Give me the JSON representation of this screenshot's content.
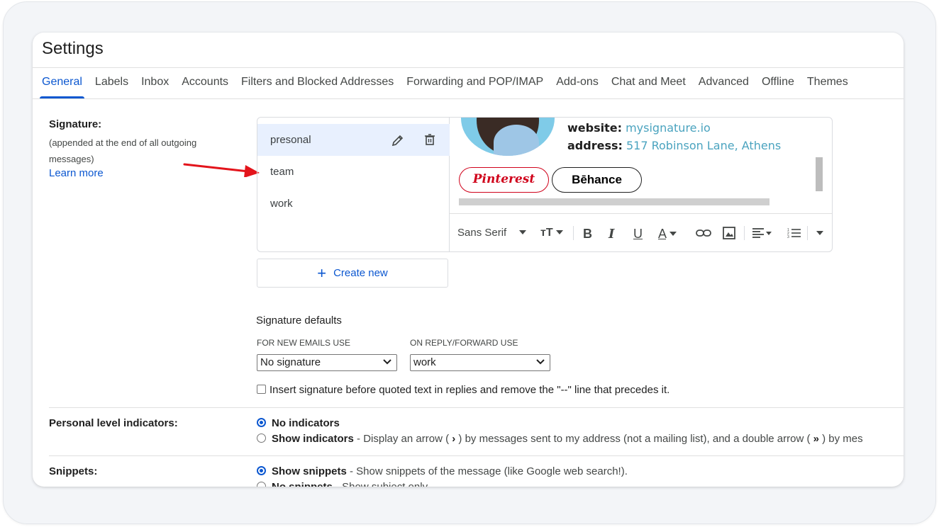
{
  "header": {
    "title": "Settings"
  },
  "tabs": [
    {
      "label": "General",
      "active": true
    },
    {
      "label": "Labels"
    },
    {
      "label": "Inbox"
    },
    {
      "label": "Accounts"
    },
    {
      "label": "Filters and Blocked Addresses"
    },
    {
      "label": "Forwarding and POP/IMAP"
    },
    {
      "label": "Add-ons"
    },
    {
      "label": "Chat and Meet"
    },
    {
      "label": "Advanced"
    },
    {
      "label": "Offline"
    },
    {
      "label": "Themes"
    }
  ],
  "signature": {
    "label": "Signature:",
    "description": "(appended at the end of all outgoing messages)",
    "learn_more": "Learn more",
    "items": [
      {
        "name": "presonal",
        "selected": true
      },
      {
        "name": "team"
      },
      {
        "name": "work"
      }
    ],
    "preview": {
      "website_key": "website:",
      "website_value": "mysignature.io",
      "address_key": "address:",
      "address_value": "517 Robinson Lane, Athens",
      "pinterest": "Pinterest",
      "behance": "Bēhance"
    },
    "toolbar": {
      "font": "Sans Serif",
      "glyph_bold": "B",
      "glyph_italic": "I",
      "glyph_underline": "U",
      "glyph_text_color": "A",
      "glyph_size": "тT"
    },
    "create_new": "Create new"
  },
  "defaults": {
    "title": "Signature defaults",
    "new_label": "FOR NEW EMAILS USE",
    "new_value": "No signature",
    "reply_label": "ON REPLY/FORWARD USE",
    "reply_value": "work"
  },
  "insert_checkbox": "Insert signature before quoted text in replies and remove the \"--\" line that precedes it.",
  "personal_level": {
    "label": "Personal level indicators:",
    "no_indicators": "No indicators",
    "show_indicators": "Show indicators",
    "show_indicators_desc_1": " - Display an arrow ( ",
    "arrow_single": "›",
    "show_indicators_desc_2": " ) by messages sent to my address (not a mailing list), and a double arrow ( ",
    "arrow_double": "»",
    "show_indicators_desc_3": " ) by mes"
  },
  "snippets": {
    "label": "Snippets:",
    "show": "Show snippets",
    "show_desc": " - Show snippets of the message (like Google web search!).",
    "no": "No snippets",
    "no_desc": " - Show subject only."
  },
  "colors": {
    "accent": "#0b57d0",
    "selected_bg": "#e8f0fe",
    "link_teal": "#4aa3bf",
    "pinterest_red": "#d0021b",
    "annotation_arrow": "#e3141b"
  }
}
